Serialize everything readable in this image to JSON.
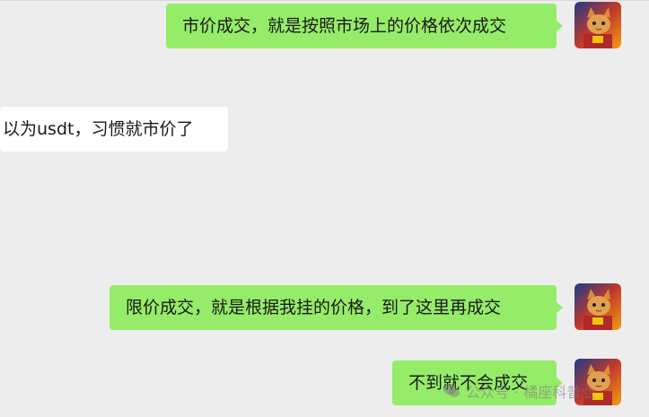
{
  "messages": [
    {
      "side": "self",
      "text": "市价成交，就是按照市场上的价格依次成交"
    },
    {
      "side": "other",
      "text": "以为usdt，习惯就市价了"
    },
    {
      "side": "self",
      "text": "限价成交，就是根据我挂的价格，到了这里再成交"
    },
    {
      "side": "self",
      "text": "不到就不会成交"
    }
  ],
  "watermark": {
    "prefix": "公众号 · ",
    "name": "橘座科普业"
  },
  "colors": {
    "background": "#ededed",
    "self_bubble": "#95ec69",
    "other_bubble": "#ffffff"
  }
}
